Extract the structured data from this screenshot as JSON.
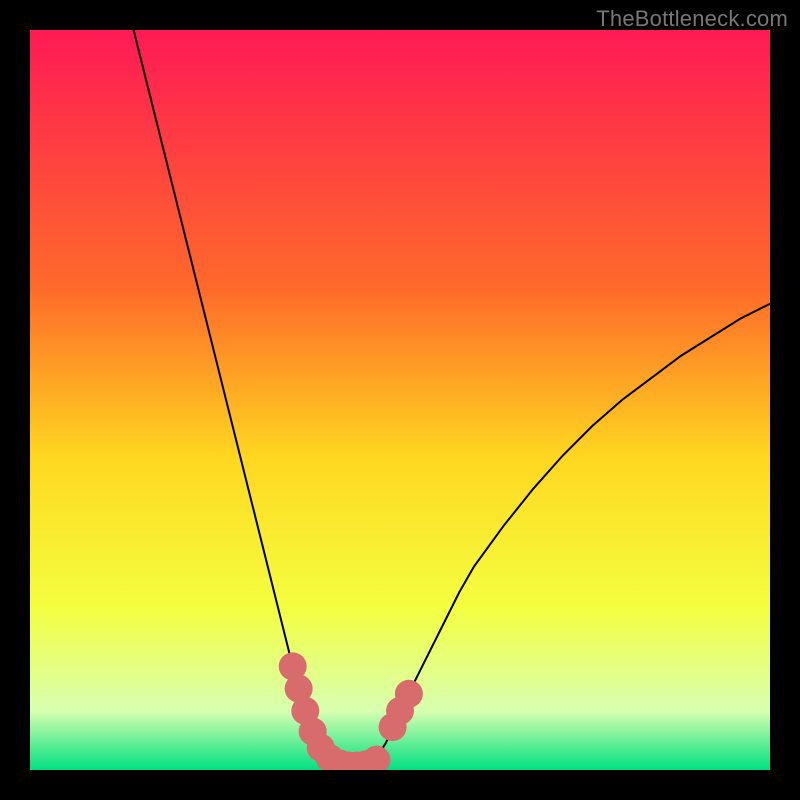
{
  "watermark": "TheBottleneck.com",
  "colors": {
    "bg": "#000000",
    "grad_top": "#ff1a55",
    "grad_mid1": "#ff6a2a",
    "grad_mid2": "#ffd820",
    "grad_mid3": "#f4ff40",
    "grad_low": "#d8ffb0",
    "grad_bottom": "#00e082",
    "curve": "#000000",
    "marker": "#d86b6b"
  },
  "chart_data": {
    "type": "line",
    "title": "",
    "xlabel": "",
    "ylabel": "",
    "xlim": [
      0,
      100
    ],
    "ylim": [
      0,
      100
    ],
    "curve": [
      [
        14,
        100
      ],
      [
        16,
        92
      ],
      [
        18,
        84
      ],
      [
        20,
        76
      ],
      [
        22,
        68
      ],
      [
        24,
        60
      ],
      [
        26,
        52
      ],
      [
        28,
        44
      ],
      [
        30,
        36
      ],
      [
        32,
        28
      ],
      [
        33,
        24
      ],
      [
        34,
        20
      ],
      [
        35,
        16
      ],
      [
        36,
        12
      ],
      [
        37,
        8
      ],
      [
        38,
        5
      ],
      [
        39,
        3
      ],
      [
        40,
        1.5
      ],
      [
        41,
        0.8
      ],
      [
        42,
        0.5
      ],
      [
        43,
        0.5
      ],
      [
        44,
        0.5
      ],
      [
        45,
        0.7
      ],
      [
        46,
        1.2
      ],
      [
        47,
        2
      ],
      [
        48,
        3.5
      ],
      [
        49,
        5.5
      ],
      [
        50,
        8
      ],
      [
        52,
        12
      ],
      [
        54,
        16
      ],
      [
        56,
        20
      ],
      [
        58,
        24
      ],
      [
        60,
        27.5
      ],
      [
        64,
        33
      ],
      [
        68,
        38
      ],
      [
        72,
        42.5
      ],
      [
        76,
        46.5
      ],
      [
        80,
        50
      ],
      [
        84,
        53
      ],
      [
        88,
        56
      ],
      [
        92,
        58.5
      ],
      [
        96,
        61
      ],
      [
        100,
        63
      ]
    ],
    "markers": [
      [
        35.5,
        14
      ],
      [
        36.3,
        11
      ],
      [
        37.2,
        8
      ],
      [
        38.2,
        5.2
      ],
      [
        39.3,
        3
      ],
      [
        40.5,
        1.6
      ],
      [
        41.8,
        0.9
      ],
      [
        43.0,
        0.6
      ],
      [
        44.2,
        0.6
      ],
      [
        45.5,
        0.8
      ],
      [
        46.8,
        1.4
      ],
      [
        49.0,
        5.8
      ],
      [
        50.0,
        8.0
      ],
      [
        51.2,
        10.3
      ]
    ],
    "marker_radius": 14
  }
}
